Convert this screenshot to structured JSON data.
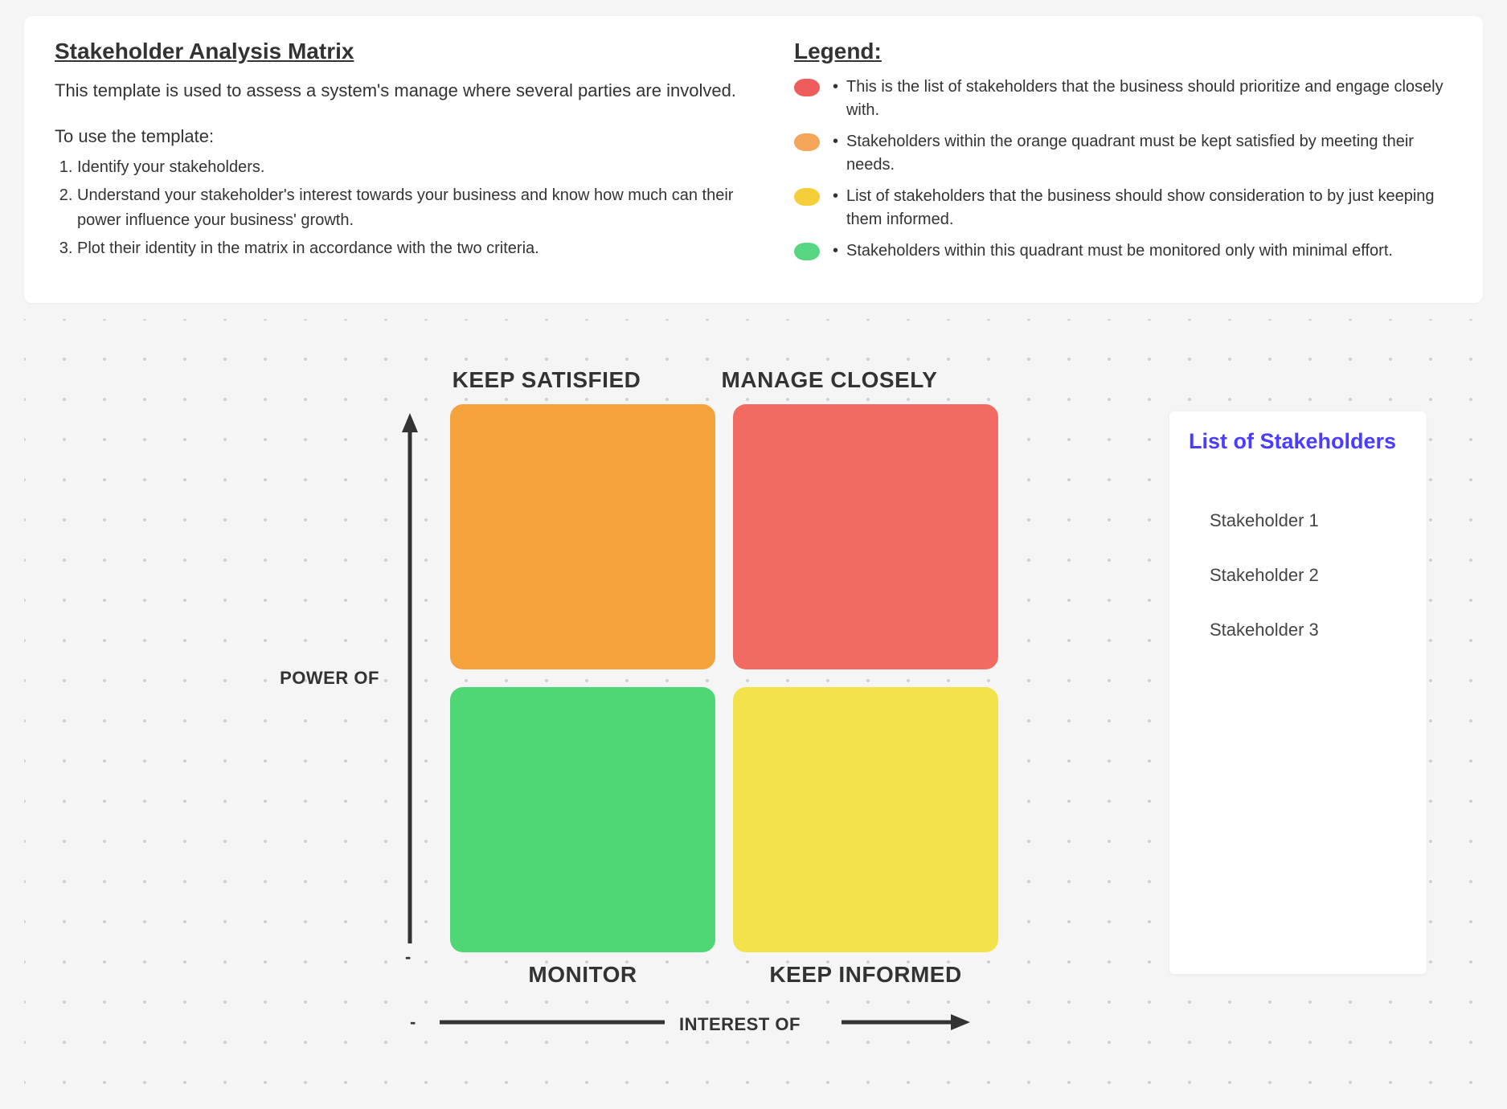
{
  "header": {
    "title": "Stakeholder Analysis Matrix",
    "description": "This template is used to assess a system's manage where several parties are involved.",
    "use_label": "To use the template:",
    "steps": [
      "Identify your stakeholders.",
      "Understand your stakeholder's interest towards your business and know how much can their power influence your business' growth.",
      "Plot their identity in the matrix in accordance with the two criteria."
    ]
  },
  "legend": {
    "title": "Legend:",
    "items": [
      {
        "color": "#ee5c5c",
        "text": "This is the list of stakeholders that the business should prioritize and engage closely with."
      },
      {
        "color": "#f4a559",
        "text": "Stakeholders within the orange quadrant must be kept satisfied by meeting their needs."
      },
      {
        "color": "#f4cf3a",
        "text": "List of stakeholders that the business should show consideration to by just keeping them informed."
      },
      {
        "color": "#57d782",
        "text": "Stakeholders within this quadrant must be monitored only with minimal effort."
      }
    ]
  },
  "matrix": {
    "y_axis_label": "POWER OF",
    "x_axis_label": "INTEREST OF",
    "y_tick_low": "-",
    "x_tick_low": "-",
    "quadrants": {
      "top_left": {
        "label": "KEEP SATISFIED",
        "color": "#f4a23c"
      },
      "top_right": {
        "label": "MANAGE CLOSELY",
        "color": "#f16b63"
      },
      "bottom_left": {
        "label": "MONITOR",
        "color": "#4fd776"
      },
      "bottom_right": {
        "label": "KEEP INFORMED",
        "color": "#f4e24a"
      }
    }
  },
  "stakeholders": {
    "title": "List of Stakeholders",
    "items": [
      "Stakeholder 1",
      "Stakeholder 2",
      "Stakeholder 3"
    ]
  },
  "chart_data": {
    "type": "quadrant-matrix",
    "title": "Stakeholder Analysis Matrix",
    "x_axis": {
      "label": "INTEREST OF",
      "low": "-",
      "direction": "increasing-right"
    },
    "y_axis": {
      "label": "POWER OF",
      "low": "-",
      "direction": "increasing-up"
    },
    "quadrants": [
      {
        "position": "top-left",
        "power": "high",
        "interest": "low",
        "label": "KEEP SATISFIED",
        "color": "#f4a23c"
      },
      {
        "position": "top-right",
        "power": "high",
        "interest": "high",
        "label": "MANAGE CLOSELY",
        "color": "#f16b63"
      },
      {
        "position": "bottom-left",
        "power": "low",
        "interest": "low",
        "label": "MONITOR",
        "color": "#4fd776"
      },
      {
        "position": "bottom-right",
        "power": "low",
        "interest": "high",
        "label": "KEEP INFORMED",
        "color": "#f4e24a"
      }
    ],
    "legend": [
      {
        "color": "#ee5c5c",
        "meaning": "prioritize and engage closely"
      },
      {
        "color": "#f4a559",
        "meaning": "keep satisfied by meeting needs"
      },
      {
        "color": "#f4cf3a",
        "meaning": "show consideration by keeping informed"
      },
      {
        "color": "#57d782",
        "meaning": "monitor with minimal effort"
      }
    ],
    "stakeholders_listed": [
      "Stakeholder 1",
      "Stakeholder 2",
      "Stakeholder 3"
    ]
  }
}
